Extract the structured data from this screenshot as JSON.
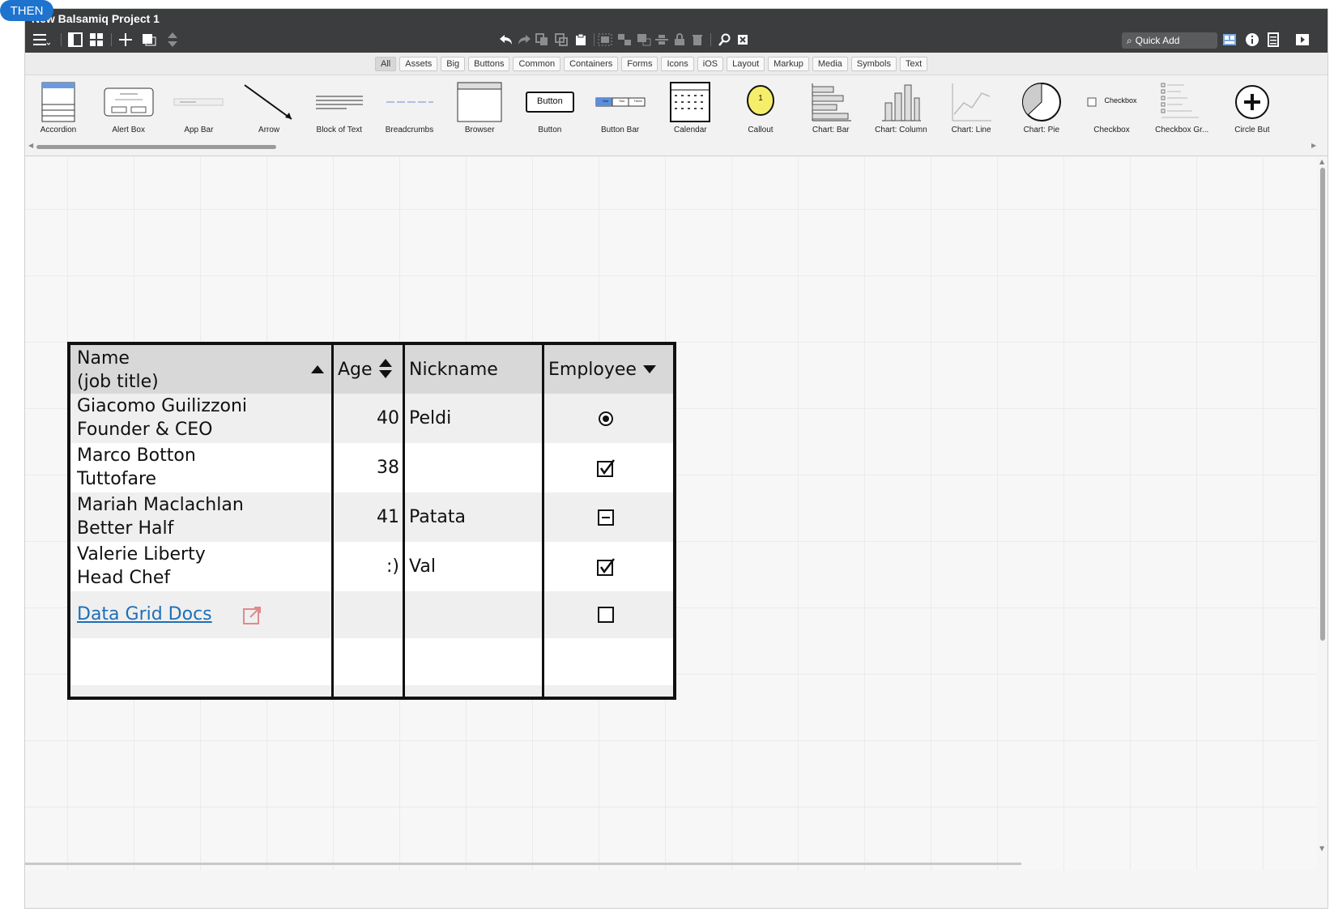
{
  "badge": "THEN",
  "window": {
    "title": "New Balsamiq Project 1"
  },
  "toolbar": {
    "quick_add_placeholder": "Quick Add"
  },
  "filter_tabs": [
    "All",
    "Assets",
    "Big",
    "Buttons",
    "Common",
    "Containers",
    "Forms",
    "Icons",
    "iOS",
    "Layout",
    "Markup",
    "Media",
    "Symbols",
    "Text"
  ],
  "active_filter": "All",
  "components": [
    {
      "label": "Accordion",
      "icon": "accordion-icon"
    },
    {
      "label": "Alert Box",
      "icon": "alert-box-icon"
    },
    {
      "label": "App Bar",
      "icon": "app-bar-icon"
    },
    {
      "label": "Arrow",
      "icon": "arrow-icon"
    },
    {
      "label": "Block of Text",
      "icon": "block-of-text-icon"
    },
    {
      "label": "Breadcrumbs",
      "icon": "breadcrumbs-icon"
    },
    {
      "label": "Browser",
      "icon": "browser-icon"
    },
    {
      "label": "Button",
      "icon": "button-icon"
    },
    {
      "label": "Button Bar",
      "icon": "button-bar-icon"
    },
    {
      "label": "Calendar",
      "icon": "calendar-icon"
    },
    {
      "label": "Callout",
      "icon": "callout-icon"
    },
    {
      "label": "Chart: Bar",
      "icon": "chart-bar-icon"
    },
    {
      "label": "Chart: Column",
      "icon": "chart-column-icon"
    },
    {
      "label": "Chart: Line",
      "icon": "chart-line-icon"
    },
    {
      "label": "Chart: Pie",
      "icon": "chart-pie-icon"
    },
    {
      "label": "Checkbox",
      "icon": "checkbox-icon"
    },
    {
      "label": "Checkbox Gr...",
      "icon": "checkbox-group-icon"
    },
    {
      "label": "Circle But",
      "icon": "circle-button-icon"
    }
  ],
  "thumb_text": {
    "button": "Button",
    "checkbox": "Checkbox",
    "callout": "1",
    "button_bar": [
      "One",
      "Two",
      "Three"
    ]
  },
  "grid": {
    "headers": {
      "name": [
        "Name",
        "(job title)"
      ],
      "age": "Age",
      "nickname": "Nickname",
      "employee": "Employee"
    },
    "rows": [
      {
        "name": "Giacomo Guilizzoni",
        "title": "Founder & CEO",
        "age": "40",
        "nickname": "Peldi",
        "employee": "radio-selected"
      },
      {
        "name": "Marco Botton",
        "title": "Tuttofare",
        "age": "38",
        "nickname": "",
        "employee": "checked"
      },
      {
        "name": "Mariah Maclachlan",
        "title": "Better Half",
        "age": "41",
        "nickname": "Patata",
        "employee": "indeterminate"
      },
      {
        "name": "Valerie Liberty",
        "title": "Head Chef",
        "age": ":)",
        "nickname": "Val",
        "employee": "checked"
      }
    ],
    "link_row": {
      "text": "Data Grid Docs",
      "employee": "unchecked"
    }
  }
}
